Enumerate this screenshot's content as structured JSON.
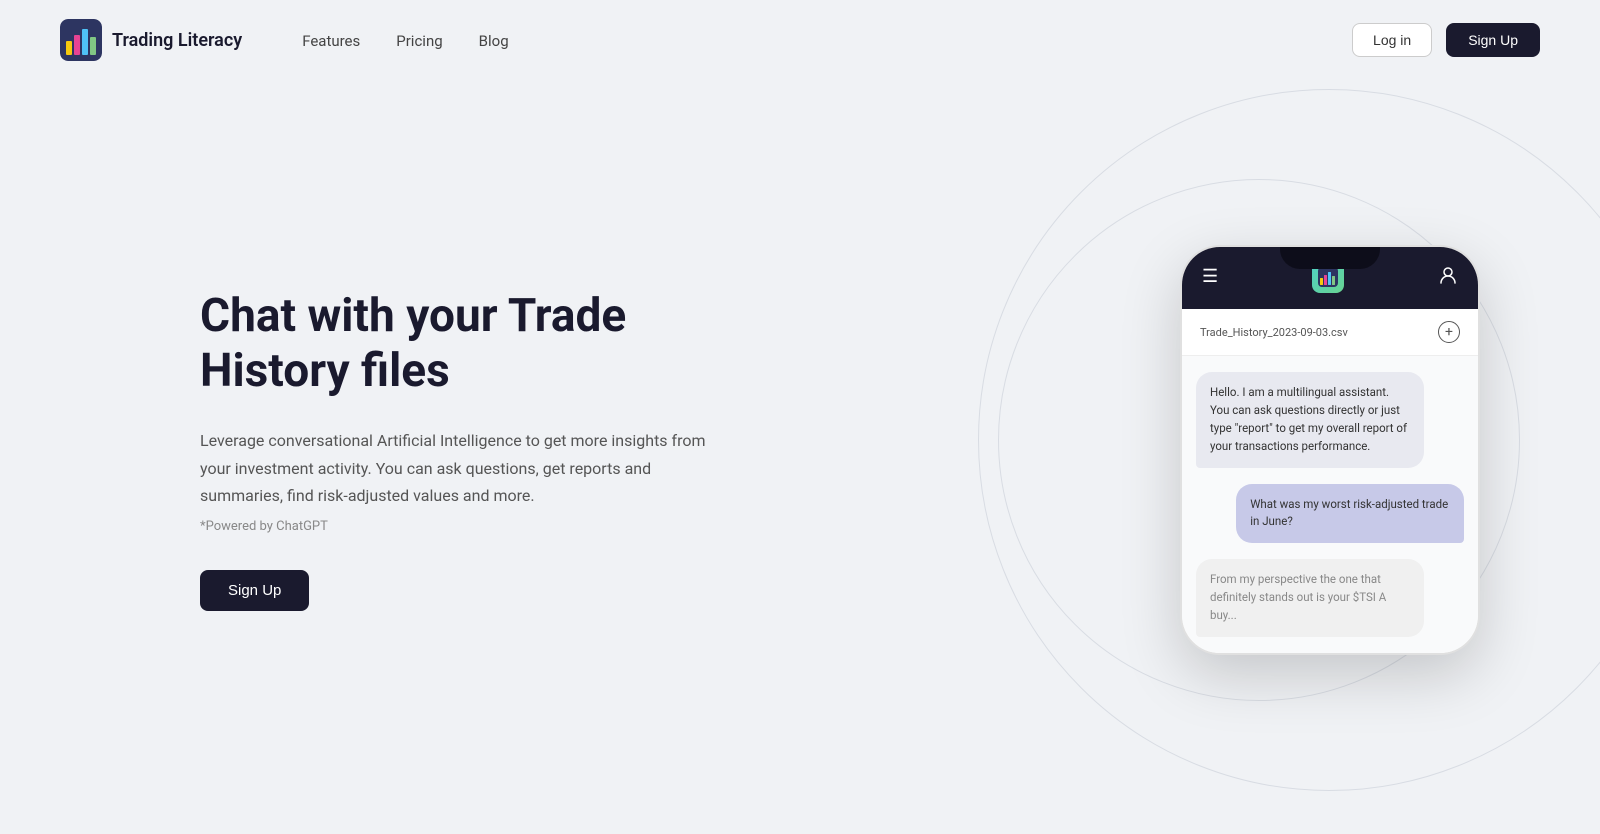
{
  "nav": {
    "logo_title": "Trading Literacy",
    "links": [
      {
        "label": "Features",
        "href": "#"
      },
      {
        "label": "Pricing",
        "href": "#"
      },
      {
        "label": "Blog",
        "href": "#"
      }
    ],
    "login_label": "Log in",
    "signup_label": "Sign Up"
  },
  "hero": {
    "title": "Chat with your Trade History files",
    "description": "Leverage conversational Artificial Intelligence to get more insights from your investment activity. You can ask questions, get reports and summaries, find risk-adjusted values and more.",
    "powered_by": "*Powered by ChatGPT",
    "signup_label": "Sign Up"
  },
  "phone": {
    "file_name": "Trade_History_2023-09-03.csv",
    "messages": [
      {
        "type": "assistant",
        "text": "Hello. I am a multilingual assistant. You can ask questions directly or just type \"report\" to get my overall report of your transactions performance."
      },
      {
        "type": "user",
        "text": "What was my worst risk-adjusted trade in June?"
      },
      {
        "type": "assistant_partial",
        "text": "From my perspective the one that definitely stands out is your $TSI A buy..."
      }
    ]
  },
  "icons": {
    "menu": "☰",
    "avatar": "👤",
    "add": "+",
    "logo_emoji": "📊"
  }
}
